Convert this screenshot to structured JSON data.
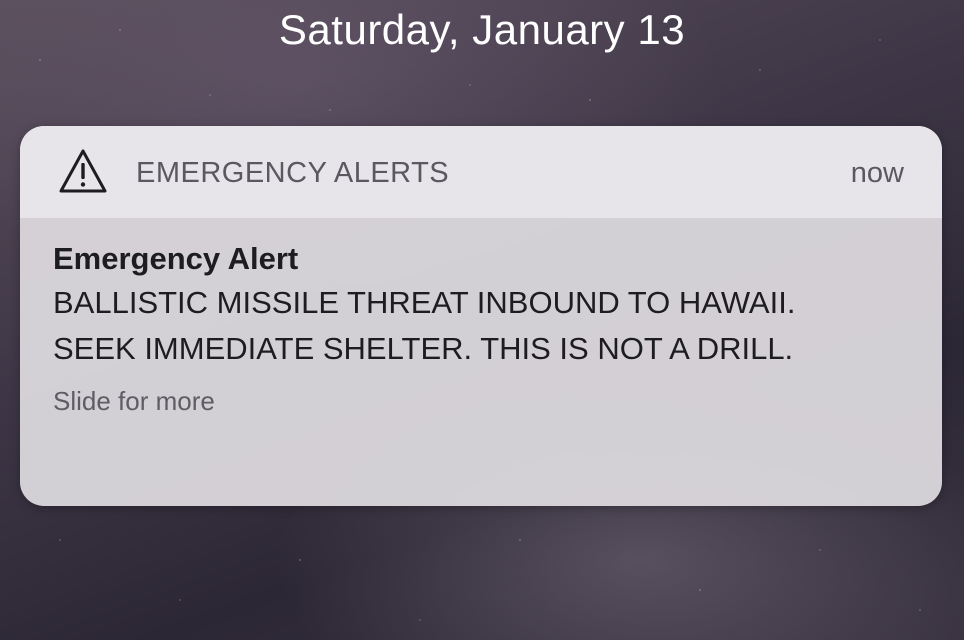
{
  "lockscreen": {
    "date": "Saturday, January 13"
  },
  "notification": {
    "app_icon": "warning-triangle-icon",
    "app_name": "EMERGENCY ALERTS",
    "time": "now",
    "title": "Emergency Alert",
    "message": "BALLISTIC MISSILE THREAT INBOUND TO HAWAII. SEEK IMMEDIATE SHELTER. THIS IS NOT A DRILL.",
    "hint": "Slide for more"
  },
  "colors": {
    "header_bg": "#e8e5ea",
    "body_bg": "#dad6dc",
    "text_primary": "#1d1c20",
    "text_secondary": "#5b5960"
  }
}
